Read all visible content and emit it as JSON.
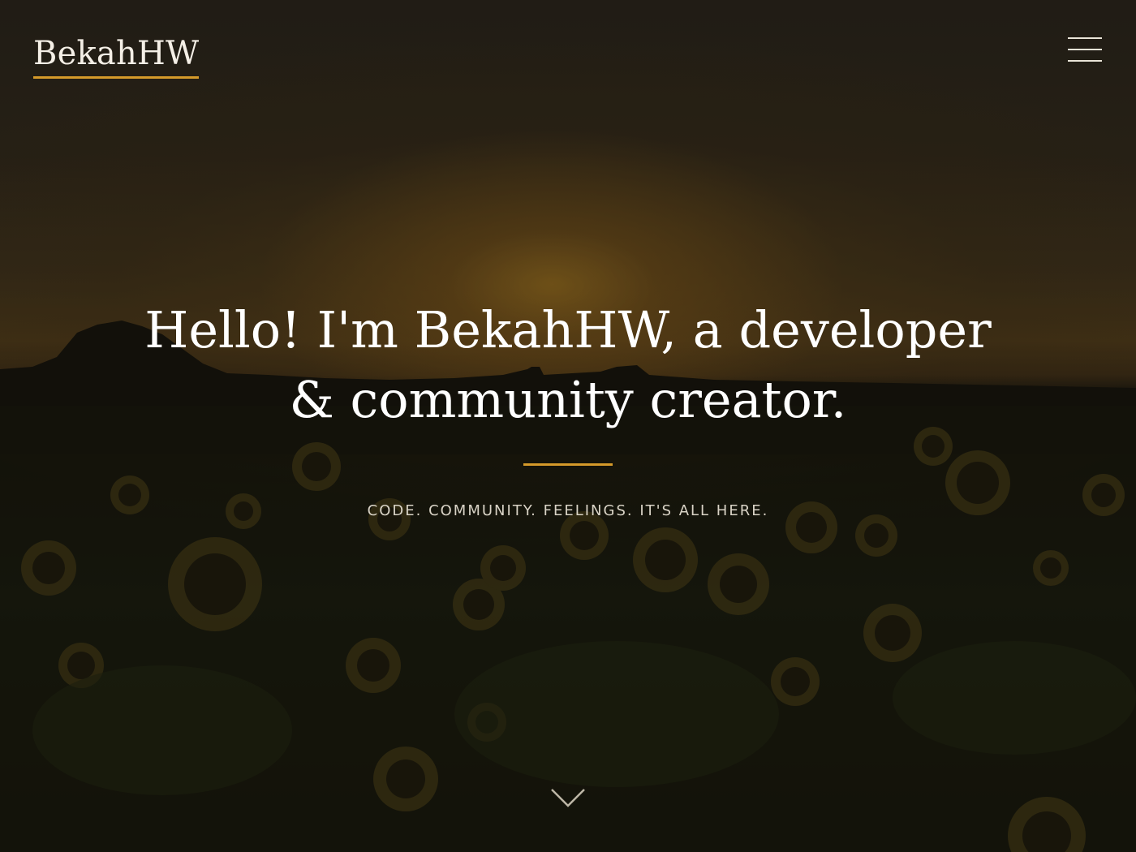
{
  "header": {
    "logo_text": "BekahHW",
    "menu_icon": "hamburger-menu-icon"
  },
  "hero": {
    "headline_line1": "Hello! I'm BekahHW, a developer",
    "headline_line2": "& community creator.",
    "tagline": "CODE. COMMUNITY. FEELINGS. IT'S ALL HERE.",
    "scroll_icon": "chevron-down-icon"
  },
  "colors": {
    "accent": "#d59a2a",
    "text": "#ffffff",
    "tagline": "#d9d3c6",
    "background_dark": "#1a1710"
  }
}
